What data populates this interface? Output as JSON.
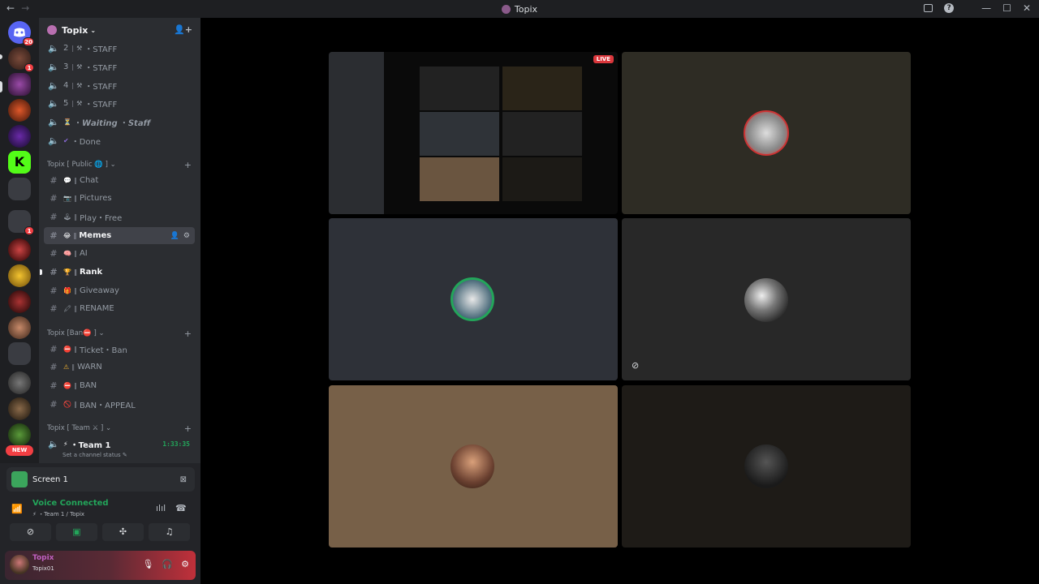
{
  "titlebar": {
    "title": "Topix",
    "back": "←",
    "forward": "→",
    "minimize": "—",
    "maximize": "☐",
    "close": "✕"
  },
  "rail": {
    "home_badge": "20",
    "badges": [
      "1",
      "1"
    ],
    "new_label": "NEW"
  },
  "guild": {
    "name": "Topix",
    "chevron": "⌄"
  },
  "voice_rows": [
    {
      "num": "2",
      "label": "・STAFF"
    },
    {
      "num": "3",
      "label": "・STAFF"
    },
    {
      "num": "4",
      "label": "・STAFF"
    },
    {
      "num": "5",
      "label": "・STAFF"
    }
  ],
  "waiting": {
    "emoji": "⏳",
    "label": "・𝙒𝙖𝙞𝙩𝙞𝙣𝙜 ・𝙎𝙩𝙖𝙛𝙛"
  },
  "done": {
    "emoji": "✔",
    "label": "・Done"
  },
  "categories": {
    "public": "Topix [ Public 🌐 ] ⌄",
    "ban": "Topix [Ban⛔ ] ⌄",
    "team": "Topix [ Team ⚔ ] ⌄"
  },
  "public_channels": [
    {
      "emoji": "💬",
      "label": "Chat",
      "bold": false
    },
    {
      "emoji": "📷",
      "label": "Pictures",
      "bold": false
    },
    {
      "emoji": "🕹",
      "label": "Play・Free",
      "bold": false
    },
    {
      "emoji": "😂",
      "label": "Memes",
      "bold": true
    },
    {
      "emoji": "🧠",
      "label": "AI",
      "bold": false
    },
    {
      "emoji": "🏆",
      "label": "Rank",
      "bold": true
    },
    {
      "emoji": "🎁",
      "label": "Giveaway",
      "bold": false
    },
    {
      "emoji": "🖍",
      "label": "RENAME",
      "bold": false
    }
  ],
  "ban_channels": [
    {
      "emoji": "⛔",
      "label": "Ticket・Ban"
    },
    {
      "emoji": "⚠",
      "label": "WARN"
    },
    {
      "emoji": "⛔",
      "label": "BAN"
    },
    {
      "emoji": "🚫",
      "label": "BAN・APPEAL"
    }
  ],
  "team_channel": {
    "emoji": "⚡",
    "label": "・Team 1",
    "timer": "1:33:35",
    "status": "Set a channel status ✎"
  },
  "panel": {
    "screen_label": "Screen 1",
    "voice_connected": "Voice Connected",
    "voice_sub": "⚡ ・Team 1 / Topix",
    "username": "Topix",
    "usertag": "Topix01"
  },
  "stage": {
    "live_label": "LIVE"
  },
  "colors": {
    "accent_green": "#23a55a",
    "danger": "#f23f43",
    "sidebar": "#2b2d31",
    "rail": "#1e1f22"
  }
}
